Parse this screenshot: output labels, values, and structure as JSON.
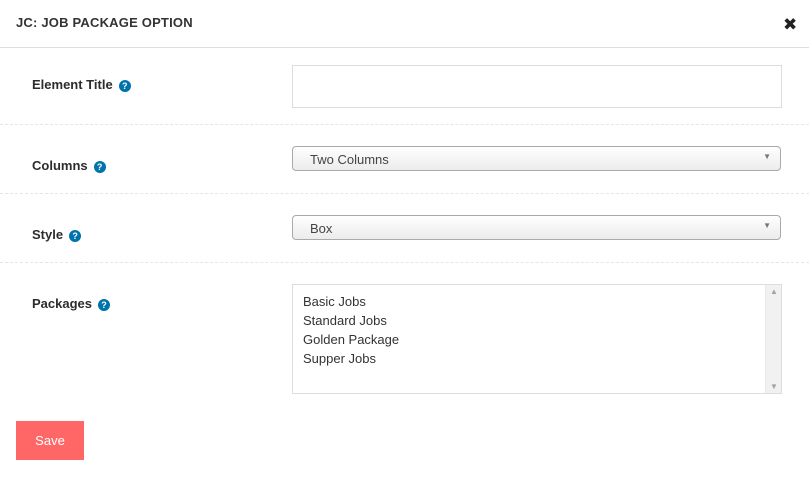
{
  "dialog": {
    "title": "JC: JOB PACKAGE OPTION",
    "close_icon": "close-icon"
  },
  "fields": {
    "element_title": {
      "label": "Element Title",
      "value": "",
      "help_icon": "help-icon"
    },
    "columns": {
      "label": "Columns",
      "value": "Two Columns",
      "help_icon": "help-icon"
    },
    "style": {
      "label": "Style",
      "value": "Box",
      "help_icon": "help-icon"
    },
    "packages": {
      "label": "Packages",
      "help_icon": "help-icon",
      "options": [
        "Basic Jobs",
        "Standard Jobs",
        "Golden Package",
        "Supper Jobs"
      ]
    }
  },
  "actions": {
    "save_label": "Save"
  },
  "colors": {
    "save_button": "#ff6666",
    "help_icon": "#0073aa"
  }
}
